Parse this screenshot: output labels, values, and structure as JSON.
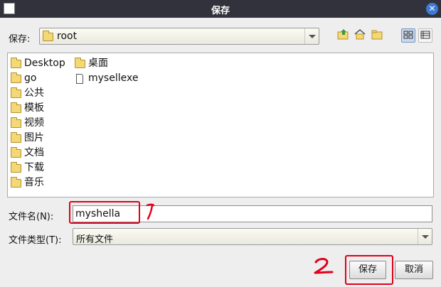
{
  "window": {
    "title": "保存"
  },
  "look_in": {
    "label": "保存:",
    "value": "root"
  },
  "columns": [
    [
      {
        "name": "Desktop",
        "type": "folder"
      },
      {
        "name": "go",
        "type": "folder"
      },
      {
        "name": "公共",
        "type": "folder"
      },
      {
        "name": "模板",
        "type": "folder"
      },
      {
        "name": "视频",
        "type": "folder"
      },
      {
        "name": "图片",
        "type": "folder"
      },
      {
        "name": "文档",
        "type": "folder"
      },
      {
        "name": "下载",
        "type": "folder"
      },
      {
        "name": "音乐",
        "type": "folder"
      }
    ],
    [
      {
        "name": "桌面",
        "type": "folder"
      },
      {
        "name": "mysellexe",
        "type": "file"
      }
    ]
  ],
  "filename": {
    "label": "文件名(N):",
    "value": "myshella"
  },
  "filetype": {
    "label": "文件类型(T):",
    "value": "所有文件"
  },
  "buttons": {
    "save": "保存",
    "cancel": "取消"
  },
  "annotations": {
    "mark1": "1",
    "mark2": "2",
    "color": "#e0001b"
  }
}
